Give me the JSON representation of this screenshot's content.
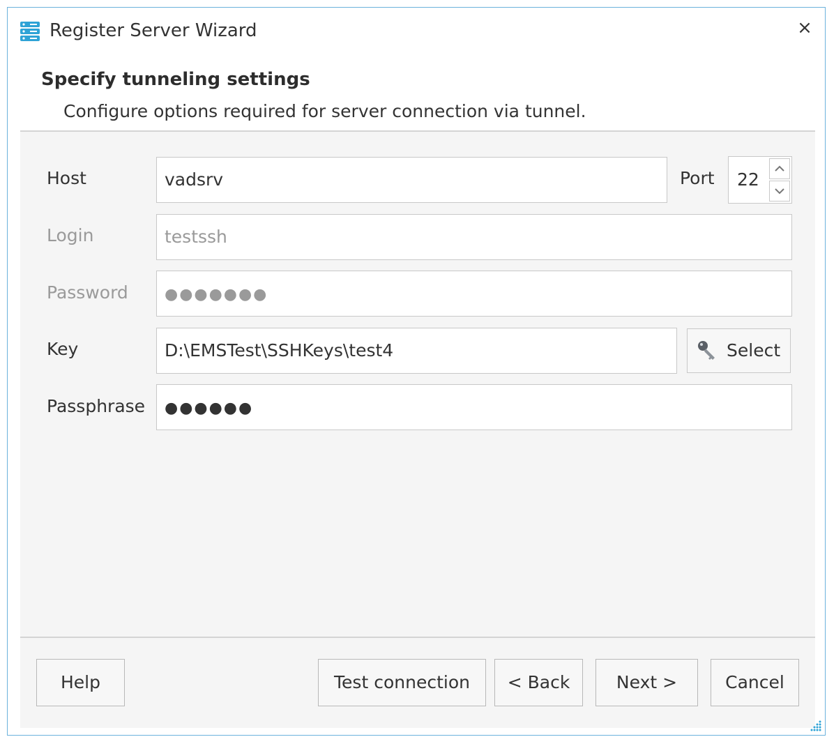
{
  "window": {
    "title": "Register Server Wizard",
    "close_label": "×",
    "app_icon": "server-stack-icon",
    "accent_color": "#2fa3d6"
  },
  "header": {
    "title": "Specify tunneling settings",
    "subtitle": "Configure options required for server connection via tunnel."
  },
  "form": {
    "host": {
      "label": "Host",
      "value": "vadsrv"
    },
    "port": {
      "label": "Port",
      "value": "22"
    },
    "login": {
      "label": "Login",
      "value": "testssh",
      "disabled": true
    },
    "password": {
      "label": "Password",
      "value": "●●●●●●●",
      "disabled": true
    },
    "key": {
      "label": "Key",
      "value": "D:\\EMSTest\\SSHKeys\\test4",
      "select_label": "Select",
      "select_icon": "key-icon"
    },
    "passphrase": {
      "label": "Passphrase",
      "value": "●●●●●●"
    }
  },
  "footer": {
    "help": "Help",
    "test_connection": "Test connection",
    "back": "< Back",
    "next": "Next >",
    "cancel": "Cancel"
  }
}
